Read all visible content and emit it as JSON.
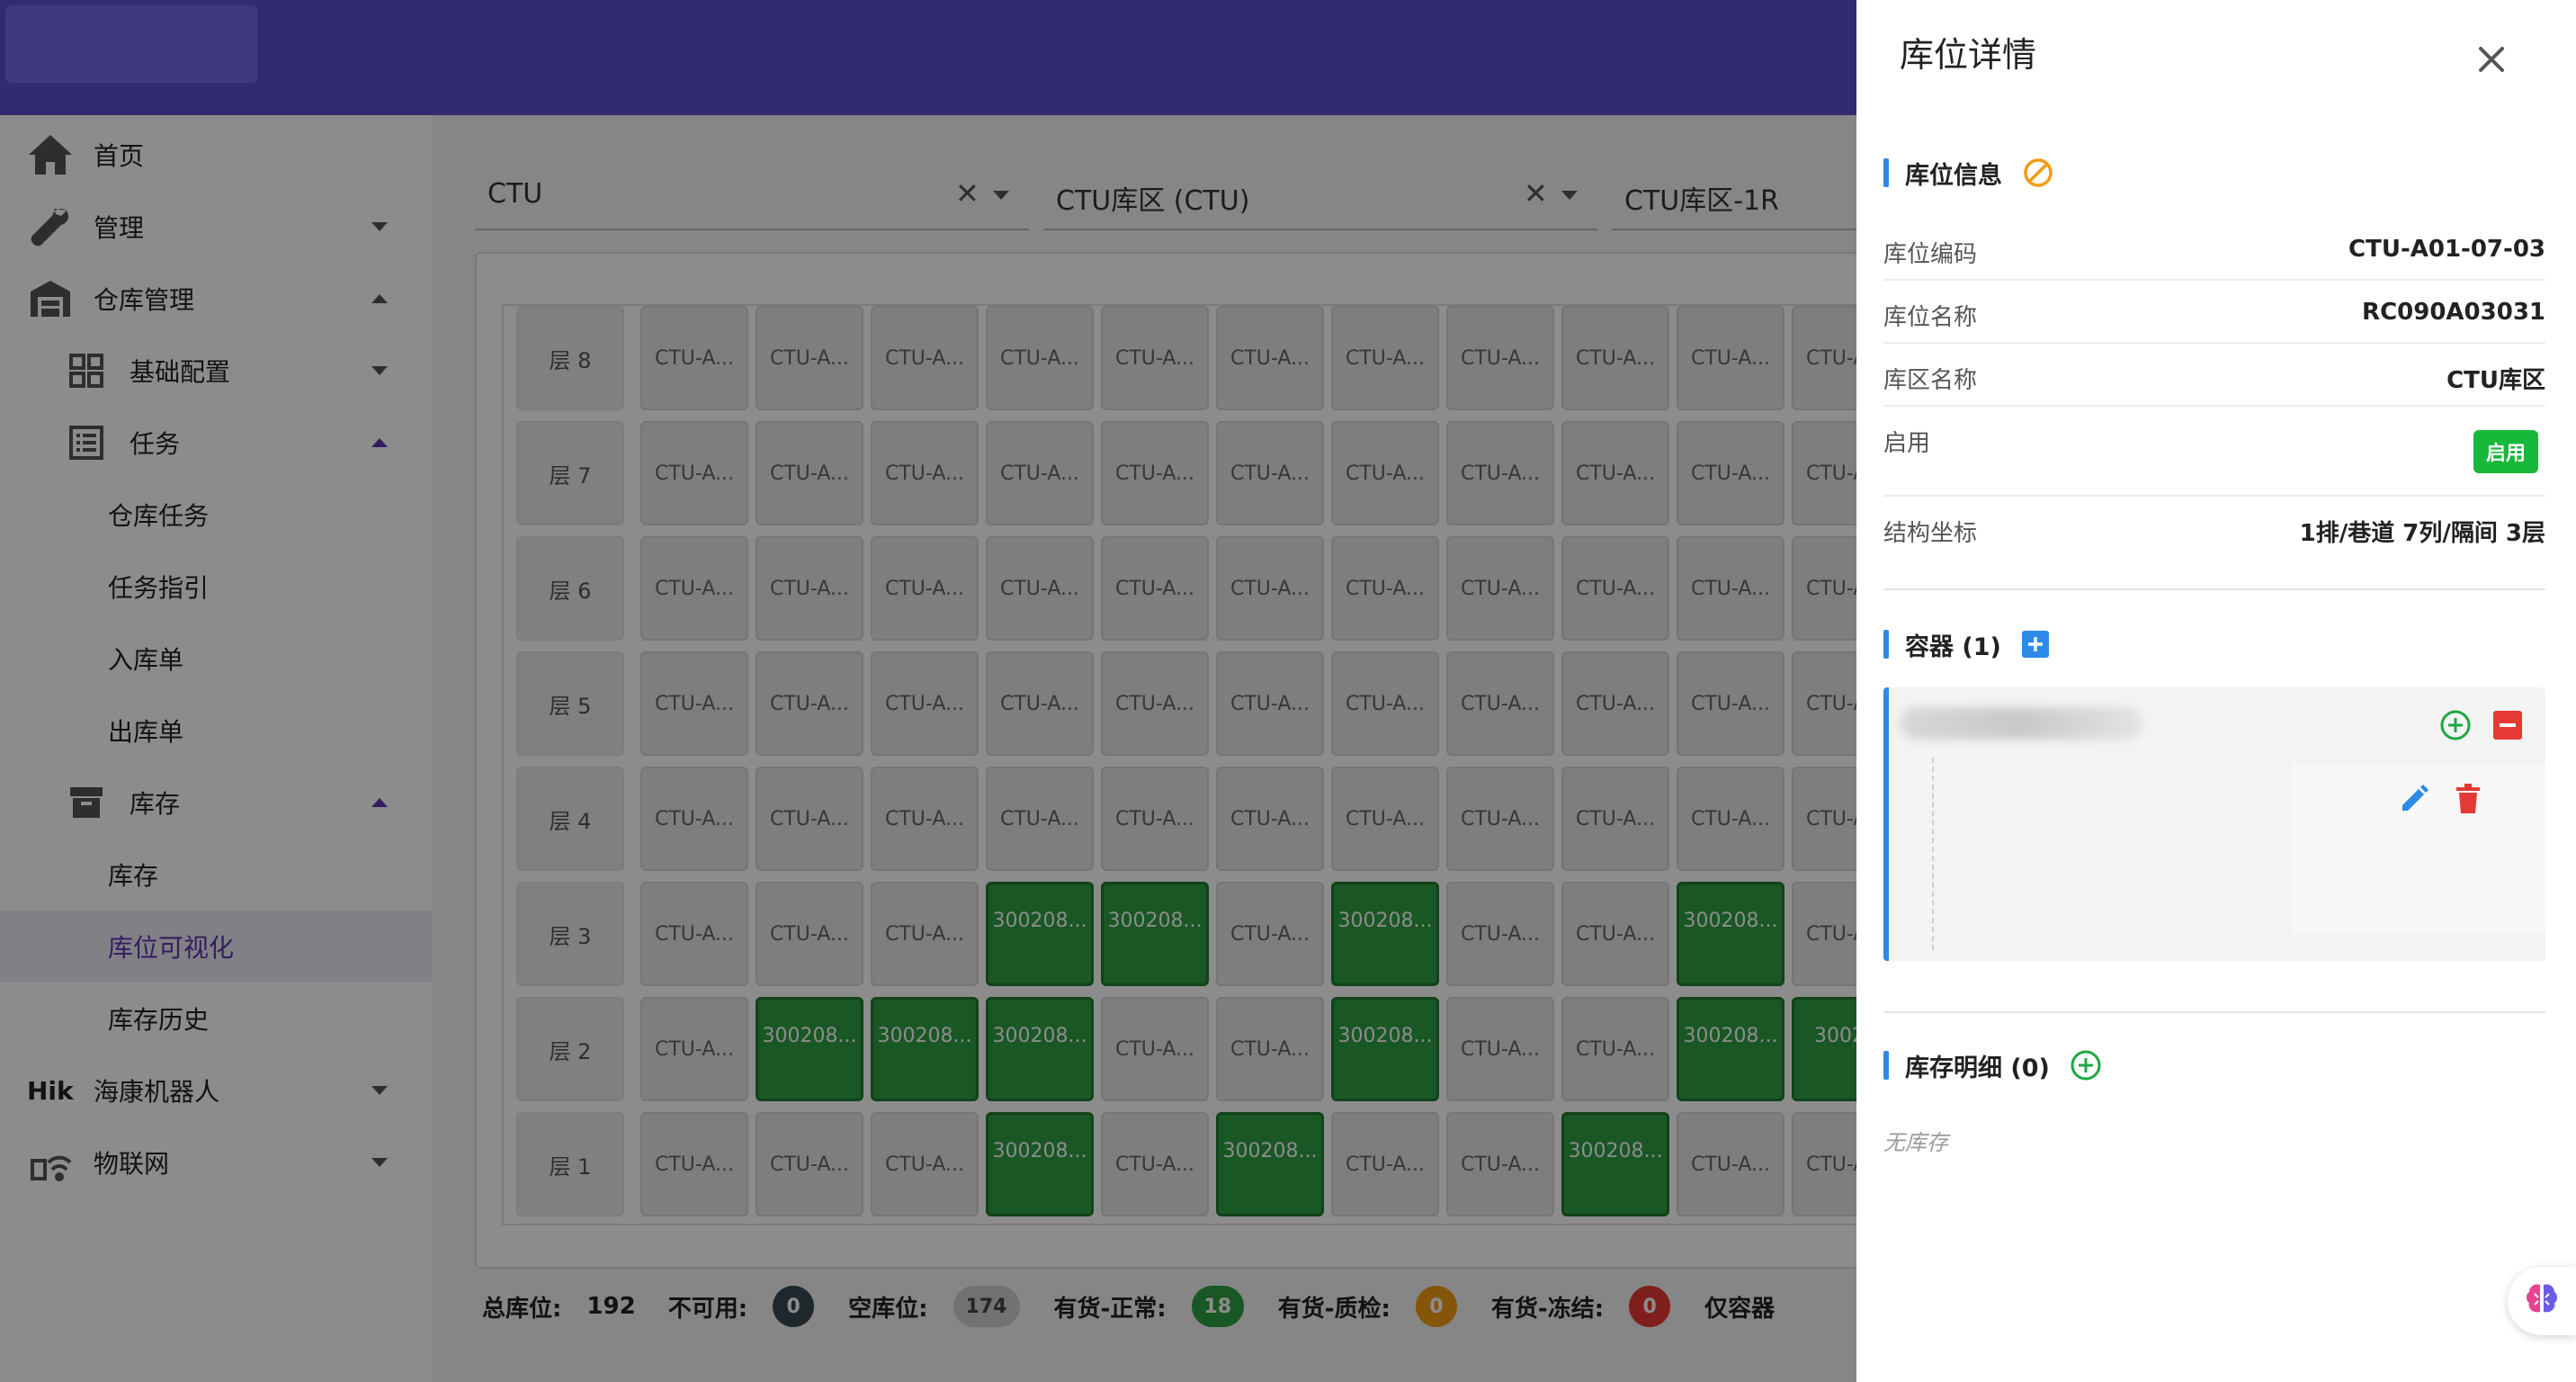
{
  "nav": {
    "home": "首页",
    "manage": "管理",
    "warehouse": "仓库管理",
    "basic_config": "基础配置",
    "tasks": "任务",
    "warehouse_tasks": "仓库任务",
    "task_guide": "任务指引",
    "inbound": "入库单",
    "outbound": "出库单",
    "inventory": "库存",
    "inventory_sub": "库存",
    "location_visual": "库位可视化",
    "inventory_history": "库存历史",
    "hik_prefix": "Hik",
    "hik": "海康机器人",
    "iot": "物联网"
  },
  "filters": {
    "f1": "CTU",
    "f2": "CTU库区 (CTU)",
    "f3": "CTU库区-1R"
  },
  "grid": {
    "layers": [
      "层 8",
      "层 7",
      "层 6",
      "层 5",
      "层 4",
      "层 3",
      "层 2",
      "层 1"
    ],
    "empty_label": "CTU-A...",
    "full_label": "300208...",
    "partial_label": "30020"
  },
  "stats": {
    "total_label": "总库位:",
    "total": "192",
    "unavailable_label": "不可用:",
    "unavailable": "0",
    "empty_label": "空库位:",
    "empty": "174",
    "normal_label": "有货-正常:",
    "normal": "18",
    "qc_label": "有货-质检:",
    "qc": "0",
    "frozen_label": "有货-冻结:",
    "frozen": "0",
    "container_only_label": "仅容器",
    "colors": {
      "unavailable": "#37474f",
      "empty": "#cfcfcf",
      "normal": "#2e9e42",
      "qc": "#f39c12",
      "frozen": "#e53935"
    }
  },
  "drawer": {
    "title": "库位详情",
    "info_section": "库位信息",
    "rows": [
      {
        "label": "库位编码",
        "value": "CTU-A01-07-03"
      },
      {
        "label": "库位名称",
        "value": "RC090A03031"
      },
      {
        "label": "库区名称",
        "value": "CTU库区"
      },
      {
        "label": "启用",
        "value": "启用"
      },
      {
        "label": "结构坐标",
        "value": "1排/巷道 7列/隔间 3层"
      }
    ],
    "container_section": "容器 (1)",
    "stock_section": "库存明细 (0)",
    "no_stock": "无库存"
  }
}
